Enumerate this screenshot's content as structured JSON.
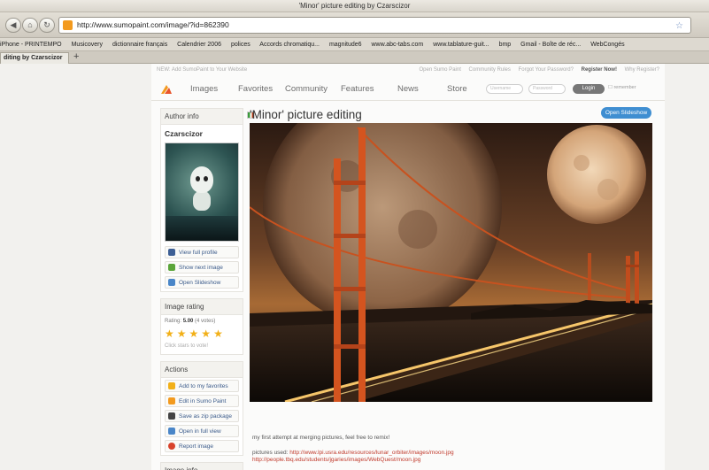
{
  "window": {
    "title": "'Minor' picture editing by Czarscizor"
  },
  "browser": {
    "url": "http://www.sumopaint.com/image/?id=862390",
    "bookmarks": [
      "iPhone - PRINTEMPO",
      "Musicovery",
      "dictionnaire français",
      "Calendrier 2006",
      "polices",
      "Accords chromatiqu...",
      "magnitude6",
      "www.abc-tabs.com",
      "www.tablature-guit...",
      "bmp",
      "Gmail - Boîte de réc...",
      "WebCongés"
    ],
    "tab_label": "diting by Czarscizor",
    "new_tab": "+"
  },
  "site": {
    "top_left": "NEW: Add SumoPaint to Your Website",
    "top_links": [
      "Open Sumo Paint",
      "Community Rules",
      "Forgot Your Password?",
      "Register Now!",
      "Why Register?"
    ],
    "nav": [
      "Images",
      "Favorites",
      "Community",
      "Features",
      "News",
      "Store"
    ],
    "username_placeholder": "Username",
    "password_placeholder": "Password",
    "login_label": "Login",
    "remember_label": "remember"
  },
  "sidebar": {
    "author_head": "Author info",
    "author_name": "Czarscizor",
    "author_buttons": [
      "View full profile",
      "Show next image",
      "Open Slideshow"
    ],
    "rating_head": "Image rating",
    "rating_label": "Rating:",
    "rating_value": "5.00",
    "rating_votes": "(4 votes)",
    "stars": 5,
    "vote_text": "Click stars to vote!",
    "actions_head": "Actions",
    "actions": [
      "Add to my favorites",
      "Edit in Sumo Paint",
      "Save as zip package",
      "Open in full view",
      "Report image"
    ],
    "info_head": "Image info"
  },
  "main": {
    "title": "'Minor' picture editing",
    "slideshow_label": "Open Slideshow",
    "caption": "my first attempt at merging pictures, feel free to remix!",
    "pictures_used_label": "pictures used:",
    "links": [
      "http://www.lpi.usra.edu/resources/lunar_orbiter/images/moon.jpg",
      "http://people.tbq.edu/students/jgaries/images/WebQuest/moon.jpg"
    ]
  },
  "colors": {
    "accent": "#3f8ed1",
    "link_red": "#c0392b",
    "star": "#f2b018"
  }
}
